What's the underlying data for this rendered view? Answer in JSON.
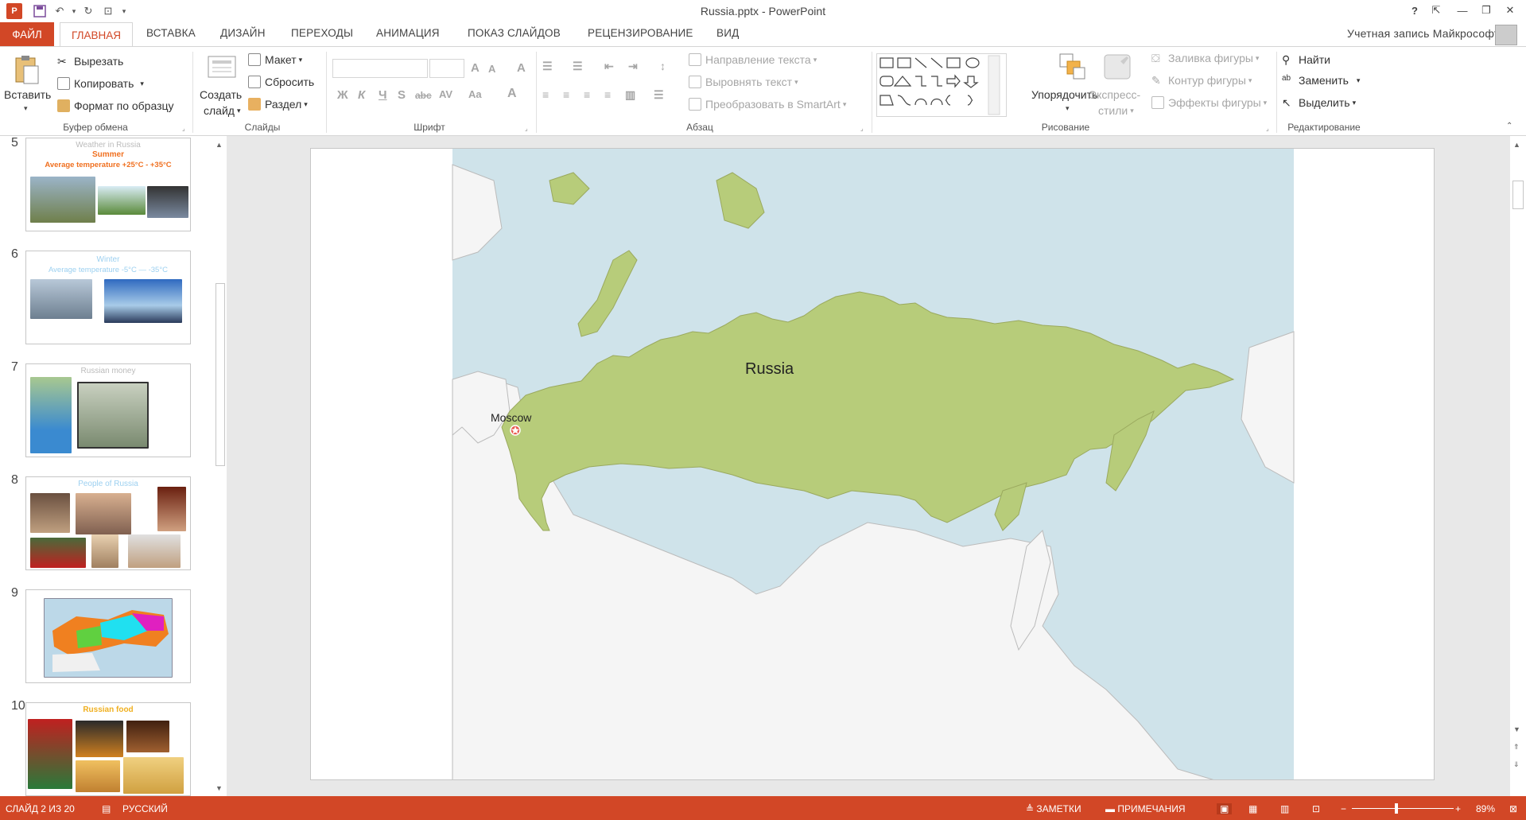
{
  "window": {
    "title": "Russia.pptx - PowerPoint",
    "help_label": "?",
    "account_label": "Учетная запись Майкрософт"
  },
  "tabs": [
    {
      "label": "ФАЙЛ"
    },
    {
      "label": "ГЛАВНАЯ"
    },
    {
      "label": "ВСТАВКА"
    },
    {
      "label": "ДИЗАЙН"
    },
    {
      "label": "ПЕРЕХОДЫ"
    },
    {
      "label": "АНИМАЦИЯ"
    },
    {
      "label": "ПОКАЗ СЛАЙДОВ"
    },
    {
      "label": "РЕЦЕНЗИРОВАНИЕ"
    },
    {
      "label": "ВИД"
    }
  ],
  "ribbon": {
    "clipboard": {
      "paste": "Вставить",
      "cut": "Вырезать",
      "copy": "Копировать",
      "format_painter": "Формат по образцу",
      "label": "Буфер обмена"
    },
    "slides": {
      "new_slide_1": "Создать",
      "new_slide_2": "слайд",
      "layout": "Макет",
      "reset": "Сбросить",
      "section": "Раздел",
      "label": "Слайды"
    },
    "font": {
      "label": "Шрифт"
    },
    "paragraph": {
      "text_direction": "Направление текста",
      "align_text": "Выровнять текст",
      "smartart": "Преобразовать в SmartArt",
      "label": "Абзац"
    },
    "drawing": {
      "arrange": "Упорядочить",
      "quick_styles_1": "Экспресс-",
      "quick_styles_2": "стили",
      "shape_fill": "Заливка фигуры",
      "shape_outline": "Контур фигуры",
      "shape_effects": "Эффекты фигуры",
      "label": "Рисование"
    },
    "editing": {
      "find": "Найти",
      "replace": "Заменить",
      "select": "Выделить",
      "label": "Редактирование"
    }
  },
  "thumbnails": [
    {
      "num": "5",
      "title": "Weather in Russia",
      "sub1": "Summer",
      "sub2": "Average temperature +25°C - +35°C"
    },
    {
      "num": "6",
      "title": "Winter",
      "sub1": "Average temperature -5°C — -35°C"
    },
    {
      "num": "7",
      "title": "Russian money"
    },
    {
      "num": "8",
      "title": "People of Russia"
    },
    {
      "num": "9"
    },
    {
      "num": "10",
      "title": "Russian food"
    }
  ],
  "slide": {
    "country_label": "Russia",
    "capital_label": "Moscow"
  },
  "status": {
    "slide_counter": "СЛАЙД 2 ИЗ 20",
    "language": "РУССКИЙ",
    "notes": "ЗАМЕТКИ",
    "comments": "ПРИМЕЧАНИЯ",
    "zoom": "89%",
    "zoom_fraction": 0.89
  },
  "colors": {
    "accent": "#d24726",
    "russia_fill": "#b7cc7a",
    "sea": "#cfe3ea",
    "land": "#f5f5f5"
  }
}
